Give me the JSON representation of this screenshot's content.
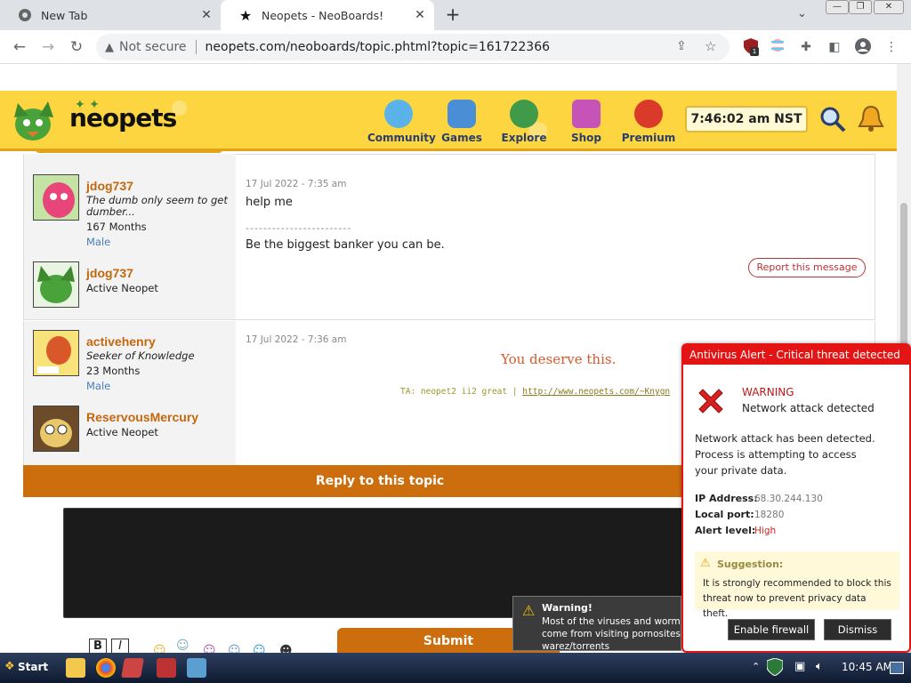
{
  "browser": {
    "tabs": [
      {
        "label": "New Tab",
        "active": false
      },
      {
        "label": "Neopets - NeoBoards!",
        "active": true
      }
    ],
    "not_secure": "Not secure",
    "url": "neopets.com/neoboards/topic.phtml?topic=161722366",
    "ext_badge": "1"
  },
  "header": {
    "logo": "neopets",
    "nav": [
      "Community",
      "Games",
      "Explore",
      "Shop",
      "Premium"
    ],
    "clock": "7:46:02 am NST"
  },
  "posts": [
    {
      "users": [
        {
          "name": "jdog737",
          "title": "The dumb only seem to get dumber...",
          "months": "167 Months",
          "gender": "Male"
        },
        {
          "name": "jdog737",
          "sub": "Active Neopet"
        }
      ],
      "date": "17 Jul 2022 - 7:35 am",
      "text": "help me",
      "divider": "------------------------",
      "signature": "Be the biggest banker you can be.",
      "report": "Report this message"
    },
    {
      "users": [
        {
          "name": "activehenry",
          "title": "Seeker of Knowledge",
          "months": "23 Months",
          "gender": "Male"
        },
        {
          "name": "ReservousMercury",
          "sub": "Active Neopet"
        }
      ],
      "date": "17 Jul 2022 - 7:36 am",
      "text": "You deserve this.",
      "sig_prefix": "TA: neopet2 ii2 great | ",
      "sig_link": "http://www.neopets.com/~Knygn"
    }
  ],
  "reply": {
    "title": "Reply to this topic",
    "submit": "Submit",
    "bold": "B",
    "italic": "I"
  },
  "alert": {
    "header": "Antivirus Alert - Critical threat detected",
    "warning": "WARNING",
    "subtitle": "Network attack detected",
    "body": "Network attack has been detected. Process is attempting to access your private data.",
    "ip_label": "IP Address:",
    "ip": "68.30.244.130",
    "port_label": "Local port:",
    "port": "18280",
    "level_label": "Alert level:",
    "level": "High",
    "suggestion_title": "Suggestion:",
    "suggestion": "It is strongly recommended to block this threat now to prevent privacy data theft.",
    "enable": "Enable firewall",
    "dismiss": "Dismiss",
    "colors": {
      "red": "#e51414"
    }
  },
  "toast": {
    "title": "Warning!",
    "text": "Most of the viruses and worms come from visiting pornosites or warez/torrents"
  },
  "taskbar": {
    "start": "Start",
    "time": "10:45 AM"
  }
}
